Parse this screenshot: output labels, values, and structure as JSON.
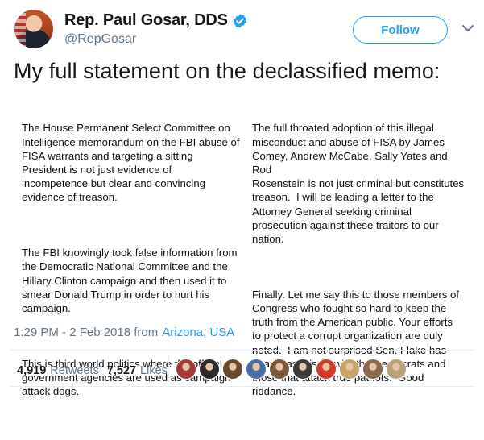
{
  "header": {
    "display_name": "Rep. Paul Gosar, DDS",
    "handle": "@RepGosar",
    "follow_label": "Follow",
    "avatar_icon": "profile-photo",
    "verified_icon": "verified-badge-icon",
    "accent_color": "#1da1f2"
  },
  "tweet": {
    "text": "My full statement on the declassified memo:",
    "statement": {
      "left_paragraphs": [
        "The House Permanent Select Committee on\nIntelligence memorandum on the FBI abuse of\nFISA warrants and targeting a sitting\nPresident is not just evidence of\nincompetence but clear and convincing\nevidence of treason.",
        "The FBI knowingly took false information from\nthe Democratic National Committee and the\nHillary Clinton campaign and then used it to\nsmear Donald Trump in order to hurt his\ncampaign.",
        "This is third world politics where the official\ngovernment agencies are used as campaign\nattack dogs."
      ],
      "right_paragraphs": [
        "The full throated adoption of this illegal\nmisconduct and abuse of FISA by James\nComey, Andrew McCabe, Sally Yates and Rod\nRosenstein is not just criminal but constitutes\ntreason.  I will be leading a letter to the\nAttorney General seeking criminal\nprosecution against these traitors to our\nnation.",
        "Finally. Let me say this to those members of\nCongress who fought so hard to keep the\ntruth from the American public. Your efforts\nto protect a corrupt organization are duly\nnoted.  I am not surprised Sen. Flake has\nagain cast his lot with the Democrats and\nthose that attack true patriots.  Good\nriddance."
      ]
    },
    "time": "1:29 PM - 2 Feb 2018 from",
    "location": "Arizona, USA"
  },
  "stats": {
    "retweets_count": "4,919",
    "retweets_label": "Retweets",
    "likes_count": "7,527",
    "likes_label": "Likes"
  },
  "likers": [
    {
      "name": "liker-1",
      "color": "#a33b3b"
    },
    {
      "name": "liker-2",
      "color": "#2b2b2b"
    },
    {
      "name": "liker-3",
      "color": "#6a4a2f"
    },
    {
      "name": "liker-4",
      "color": "#4a6fa5"
    },
    {
      "name": "liker-5",
      "color": "#7a5a3a"
    },
    {
      "name": "liker-6",
      "color": "#3a3a3a"
    },
    {
      "name": "liker-7",
      "color": "#d23b2c"
    },
    {
      "name": "liker-8",
      "color": "#c9a26b"
    },
    {
      "name": "liker-9",
      "color": "#8a6a4a"
    },
    {
      "name": "liker-10",
      "color": "#b9a27a"
    }
  ]
}
